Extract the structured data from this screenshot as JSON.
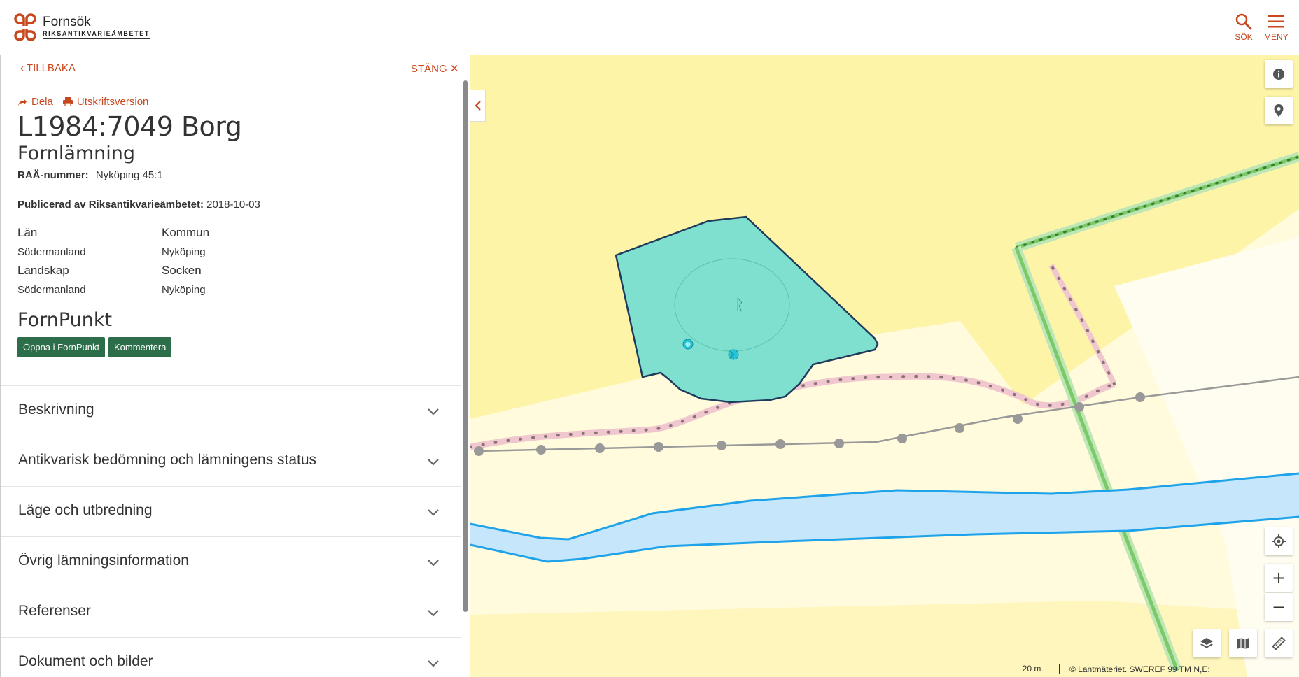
{
  "header": {
    "logo_title": "Fornsök",
    "logo_subtitle": "RIKSANTIKVARIEÄMBETET",
    "search_label": "SÖK",
    "menu_label": "MENY"
  },
  "panel": {
    "back_label": "TILLBAKA",
    "close_label": "STÄNG",
    "share_label": "Dela",
    "print_label": "Utskriftsversion",
    "title": "L1984:7049 Borg",
    "subtitle": "Fornlämning",
    "raa_label": "RAÄ-nummer:",
    "raa_value": "Nyköping 45:1",
    "published_label": "Publicerad av Riksantikvarieämbetet:",
    "published_value": "2018-10-03",
    "lan_label": "Län",
    "lan_value": "Södermanland",
    "kommun_label": "Kommun",
    "kommun_value": "Nyköping",
    "landskap_label": "Landskap",
    "landskap_value": "Södermanland",
    "socken_label": "Socken",
    "socken_value": "Nyköping",
    "fornpunkt_heading": "FornPunkt",
    "open_fornpunkt_label": "Öppna i FornPunkt",
    "comment_label": "Kommentera",
    "sections": [
      "Beskrivning",
      "Antikvarisk bedömning och lämningens status",
      "Läge och utbredning",
      "Övrig lämningsinformation",
      "Referenser",
      "Dokument och bilder"
    ]
  },
  "map": {
    "zoom_in": "+",
    "zoom_out": "−",
    "scale_label": "20 m",
    "attribution": "© Lantmäteriet. SWEREF 99 TM N,E:",
    "colors": {
      "accent": "#c8471c",
      "button_green": "#2c6e49",
      "polygon_fill": "#7fe0cf",
      "water": "#c6e6fb",
      "water_line": "#1ea3ea",
      "land_yellow": "#fef4a7",
      "land_light": "#fffbdc",
      "green_line": "#7cc96a"
    }
  }
}
